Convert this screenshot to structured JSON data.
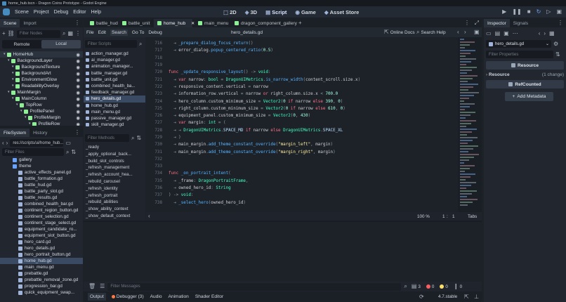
{
  "window": {
    "title": "home_hub.tscn - Dragon Coins Prototype - Godot Engine"
  },
  "menu": [
    "Scene",
    "Project",
    "Debug",
    "Editor",
    "Help"
  ],
  "workspaces": [
    {
      "label": "2D",
      "icon": "2d-icon"
    },
    {
      "label": "3D",
      "icon": "3d-icon"
    },
    {
      "label": "Script",
      "icon": "script-icon"
    },
    {
      "label": "Game",
      "icon": "game-icon"
    },
    {
      "label": "Asset Store",
      "icon": "asset-store-icon"
    }
  ],
  "scene_dock": {
    "tabs": [
      "Scene",
      "Import"
    ],
    "filter_placeholder": "Filter Nodes",
    "remote_label": "Remote",
    "local_label": "Local",
    "nodes": [
      {
        "name": "HomeHub",
        "indent": 0,
        "color": "#8eef97"
      },
      {
        "name": "BackgroundLayer",
        "indent": 1,
        "color": "#8eef97"
      },
      {
        "name": "BackgroundTexture",
        "indent": 2,
        "color": "#8eef97"
      },
      {
        "name": "BackgroundArt",
        "indent": 2,
        "color": "#8eef97"
      },
      {
        "name": "EnvironmentGlow",
        "indent": 2,
        "color": "#8eef97"
      },
      {
        "name": "ReadabilityOverlay",
        "indent": 2,
        "color": "#8eef97"
      },
      {
        "name": "MainMargin",
        "indent": 1,
        "color": "#8eef97"
      },
      {
        "name": "MainColumn",
        "indent": 2,
        "color": "#8eef97"
      },
      {
        "name": "TopRow",
        "indent": 3,
        "color": "#8eef97"
      },
      {
        "name": "ProfilePanel",
        "indent": 4,
        "color": "#8eef97"
      },
      {
        "name": "ProfileMargin",
        "indent": 5,
        "color": "#8eef97"
      },
      {
        "name": "ProfileRow",
        "indent": 6,
        "color": "#8eef97"
      }
    ]
  },
  "filesystem_dock": {
    "tabs": [
      "FileSystem",
      "History"
    ],
    "path": "res://scripts/ui/home_hub...",
    "filter_placeholder": "Filter Files",
    "items": [
      {
        "name": "gallery",
        "type": "folder"
      },
      {
        "name": "theme",
        "type": "folder"
      },
      {
        "name": "active_effects_panel.gd",
        "type": "script"
      },
      {
        "name": "battle_formation.gd",
        "type": "script"
      },
      {
        "name": "battle_hud.gd",
        "type": "script"
      },
      {
        "name": "battle_party_slot.gd",
        "type": "script"
      },
      {
        "name": "battle_results.gd",
        "type": "script"
      },
      {
        "name": "combined_health_bar.gd",
        "type": "script"
      },
      {
        "name": "continent_region_button.gd",
        "type": "script"
      },
      {
        "name": "continent_selection.gd",
        "type": "script"
      },
      {
        "name": "continent_stage_select.gd",
        "type": "script"
      },
      {
        "name": "equipment_candidate_ro...",
        "type": "script"
      },
      {
        "name": "equipment_slot_button.gd",
        "type": "script"
      },
      {
        "name": "hero_card.gd",
        "type": "script"
      },
      {
        "name": "hero_details.gd",
        "type": "script"
      },
      {
        "name": "hero_portrait_button.gd",
        "type": "script"
      },
      {
        "name": "home_hub.gd",
        "type": "script",
        "selected": true
      },
      {
        "name": "main_menu.gd",
        "type": "script"
      },
      {
        "name": "prebattle.gd",
        "type": "script"
      },
      {
        "name": "prebattle_removal_zone.gd",
        "type": "script"
      },
      {
        "name": "progression_bar.gd",
        "type": "script"
      },
      {
        "name": "quick_equipment_swap...",
        "type": "script"
      }
    ]
  },
  "scene_tabs": [
    {
      "label": "battle_hud",
      "icon": "#8eef97"
    },
    {
      "label": "battle_unit",
      "icon": "#8eef97"
    },
    {
      "label": "home_hub",
      "icon": "#8eef97",
      "active": true
    },
    {
      "label": "main_menu",
      "icon": "#8eef97"
    },
    {
      "label": "dragon_component_gallery",
      "icon": "#8eef97"
    }
  ],
  "script_menu": [
    "File",
    "Edit",
    "Search",
    "Go To",
    "Debug"
  ],
  "script_toolbar": {
    "current_file": "hero_details.gd",
    "online_docs": "Online Docs",
    "search_help": "Search Help"
  },
  "scripts_panel": {
    "filter_placeholder": "Filter Scripts",
    "files": [
      "action_manager.gd",
      "ai_manager.gd",
      "animation_manager...",
      "battle_manager.gd",
      "battle_unit.gd",
      "combined_health_ba...",
      "feedback_manager.gd",
      "hero_details.gd",
      "home_hub.gd",
      "main_menu.gd",
      "passive_manager.gd",
      "skill_manager.gd"
    ],
    "selected": "hero_details.gd",
    "methods_placeholder": "Filter Methods",
    "methods": [
      "_ready",
      "_apply_optional_back...",
      "_build_slot_controls",
      "_refresh_management",
      "_refresh_account_hea...",
      "_rebuild_carousel",
      "_refresh_identity",
      "_refresh_portrait",
      "_rebuild_abilities",
      "_show_ability_context",
      "_show_default_context"
    ]
  },
  "code": [
    {
      "n": "716",
      "t": "  ⇥ _prepare_dialog_focus_return()"
    },
    {
      "n": "717",
      "t": "  ⇥ error_dialog.popup_centered_ratio(0.5)"
    },
    {
      "n": "718",
      "t": ""
    },
    {
      "n": "719",
      "t": ""
    },
    {
      "n": "720",
      "t": "func _update_responsive_layout() -> void:"
    },
    {
      "n": "721",
      "t": "  ⇥ var narrow: bool = DragonUIMetrics.is_narrow_width(content_scroll.size.x)"
    },
    {
      "n": "722",
      "t": "  ⇥ responsive_content.vertical = narrow"
    },
    {
      "n": "723",
      "t": "  ⇥ information_row.vertical = narrow or right_column.size.x < 700.0"
    },
    {
      "n": "724",
      "t": "  ⇥ hero_column.custom_minimum_size = Vector2(0 if narrow else 390, 0)"
    },
    {
      "n": "725",
      "t": "  ⇥ right_column.custom_minimum_size = Vector2(0 if narrow else 610, 0)"
    },
    {
      "n": "726",
      "t": "  ⇥ equipment_panel.custom_minimum_size = Vector2(0, 430)"
    },
    {
      "n": "727",
      "t": "  ⇥ var margin: int = ("
    },
    {
      "n": "728",
      "t": "  ⇥ ⇥ DragonUIMetrics.SPACE_MD if narrow else DragonUIMetrics.SPACE_XL"
    },
    {
      "n": "729",
      "t": "  ⇥ )"
    },
    {
      "n": "730",
      "t": "  ⇥ main_margin.add_theme_constant_override(\"margin_left\", margin)"
    },
    {
      "n": "731",
      "t": "  ⇥ main_margin.add_theme_constant_override(\"margin_right\", margin)"
    },
    {
      "n": "732",
      "t": ""
    },
    {
      "n": "733",
      "t": ""
    },
    {
      "n": "734",
      "t": "func _on_portrait_intent("
    },
    {
      "n": "735",
      "t": "  ⇥ _frame: DragonPortraitFrame,"
    },
    {
      "n": "736",
      "t": "  ⇥ owned_hero_id: String"
    },
    {
      "n": "737",
      "t": ") -> void:"
    },
    {
      "n": "738",
      "t": "  ⇥ _select_hero(owned_hero_id)"
    }
  ],
  "editor_status": {
    "zoom": "100 %",
    "line": "1",
    "col": "1",
    "indent": "Tabs"
  },
  "output_panel": {
    "filter_placeholder": "Filter Messages",
    "count_all": "3",
    "errors": "0",
    "warnings": "0",
    "info": "0"
  },
  "bottom_tabs": [
    "Output",
    "Debugger (3)",
    "Audio",
    "Animation",
    "Shader Editor"
  ],
  "version": "4.7.stable",
  "inspector": {
    "tabs": [
      "Inspector",
      "Signals"
    ],
    "resource_name": "hero_details.gd",
    "filter_placeholder": "Filter Properties",
    "resource_button": "Resource",
    "section_resource": "Resource",
    "section_change": "(1 change)",
    "refcounted": "RefCounted",
    "add_metadata": "Add Metadata"
  },
  "colors": {
    "accent": "#4a8eea",
    "script_tab": "#dbe5ff",
    "node_green": "#8eef97"
  }
}
